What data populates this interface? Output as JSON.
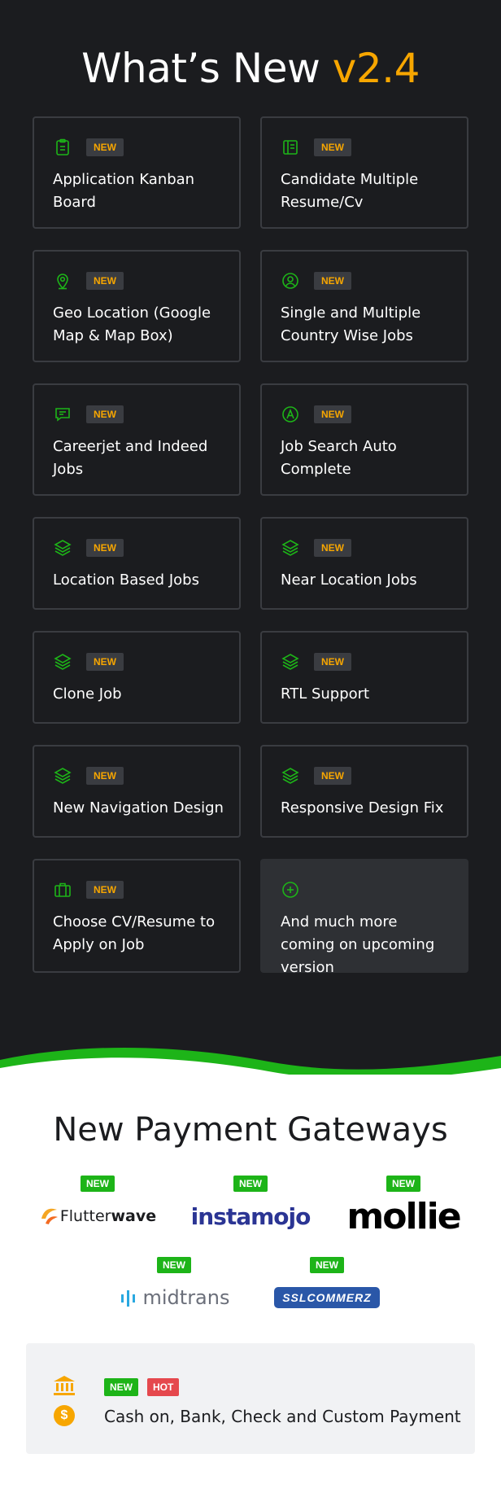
{
  "header": {
    "title_prefix": "What’s New",
    "version": "v2.4"
  },
  "features": [
    {
      "icon": "clipboard-icon",
      "badge": "NEW",
      "label": "Application Kanban Board"
    },
    {
      "icon": "resume-icon",
      "badge": "NEW",
      "label": "Candidate Multiple Resume/Cv"
    },
    {
      "icon": "map-pin-icon",
      "badge": "NEW",
      "label": "Geo Location (Google Map & Map Box)"
    },
    {
      "icon": "user-circle-icon",
      "badge": "NEW",
      "label": "Single and Multiple Country Wise Jobs"
    },
    {
      "icon": "message-icon",
      "badge": "NEW",
      "label": "Careerjet and Indeed Jobs"
    },
    {
      "icon": "autocomplete-icon",
      "badge": "NEW",
      "label": "Job Search Auto Complete"
    },
    {
      "icon": "layers-icon",
      "badge": "NEW",
      "label": "Location Based Jobs"
    },
    {
      "icon": "layers-icon",
      "badge": "NEW",
      "label": "Near Location Jobs"
    },
    {
      "icon": "layers-icon",
      "badge": "NEW",
      "label": "Clone Job"
    },
    {
      "icon": "layers-icon",
      "badge": "NEW",
      "label": "RTL Support"
    },
    {
      "icon": "layers-icon",
      "badge": "NEW",
      "label": "New Navigation Design"
    },
    {
      "icon": "layers-icon",
      "badge": "NEW",
      "label": "Responsive Design Fix"
    },
    {
      "icon": "briefcase-icon",
      "badge": "NEW",
      "label": "Choose CV/Resume to Apply on Job"
    },
    {
      "icon": "plus-circle-icon",
      "badge": "",
      "label": "And much more coming on upcoming version"
    }
  ],
  "payments": {
    "title": "New Payment Gateways",
    "gateways": [
      {
        "badge": "NEW",
        "name": "Flutterwave",
        "name_a": "Flutter",
        "name_b": "wave"
      },
      {
        "badge": "NEW",
        "name": "instamojo"
      },
      {
        "badge": "NEW",
        "name": "mollie"
      },
      {
        "badge": "NEW",
        "name": "midtrans"
      },
      {
        "badge": "NEW",
        "name": "SSLCOMMERZ"
      }
    ],
    "offline": {
      "badge_new": "NEW",
      "badge_hot": "HOT",
      "label": "Cash on, Bank, Check and Custom Payment",
      "bank_icon": "bank-icon",
      "coin_icon": "dollar-coin-icon",
      "coin_symbol": "$"
    }
  },
  "colors": {
    "accent": "#f7a600",
    "green": "#1db418",
    "hot": "#e5484d",
    "dark": "#1b1c1f"
  }
}
